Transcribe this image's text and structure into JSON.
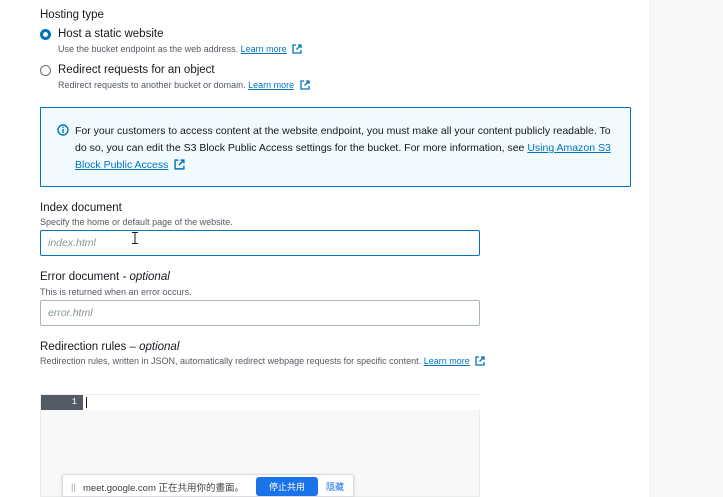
{
  "hosting_type": {
    "title": "Hosting type",
    "options": [
      {
        "label": "Host a static website",
        "description": "Use the bucket endpoint as the web address.",
        "link": "Learn more",
        "selected": true
      },
      {
        "label": "Redirect requests for an object",
        "description": "Redirect requests to another bucket or domain.",
        "link": "Learn more",
        "selected": false
      }
    ]
  },
  "info_alert": {
    "text": "For your customers to access content at the website endpoint, you must make all your content publicly readable. To do so, you can edit the S3 Block Public Access settings for the bucket. For more information, see",
    "link": "Using Amazon S3 Block Public Access",
    "icon": "info-icon"
  },
  "index_document": {
    "label": "Index document",
    "description": "Specify the home or default page of the website.",
    "placeholder": "index.html",
    "value": ""
  },
  "error_document": {
    "label": "Error document",
    "optional": "- optional",
    "description": "This is returned when an error occurs.",
    "placeholder": "error.html",
    "value": ""
  },
  "redirection_rules": {
    "label": "Redirection rules",
    "optional": "– optional",
    "description": "Redirection rules, written in JSON, automatically redirect webpage requests for specific content.",
    "link": "Learn more",
    "line_number": "1"
  },
  "screen_share_bar": {
    "grip": "||",
    "text": "meet.google.com 正在共用你的畫面。",
    "stop_button": "停止共用",
    "hide_link": "隱藏"
  },
  "colors": {
    "accent": "#0073bb",
    "info_bg": "#f1faff",
    "meet_blue": "#1a73e8"
  }
}
